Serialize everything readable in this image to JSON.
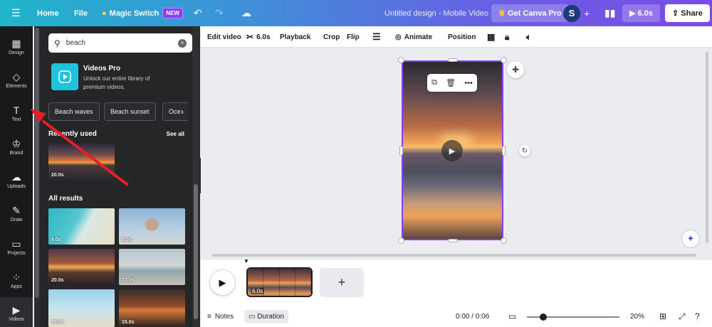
{
  "topbar": {
    "home": "Home",
    "file": "File",
    "magic_switch": "Magic Switch",
    "new_badge": "NEW",
    "design_title": "Untitled design - Mobile Video",
    "get_pro": "Get Canva Pro",
    "avatar_letter": "S",
    "play_duration": "6.0s",
    "share": "Share"
  },
  "rail": {
    "items": [
      {
        "label": "Design",
        "icon": "layout-icon"
      },
      {
        "label": "Elements",
        "icon": "shapes-icon"
      },
      {
        "label": "Text",
        "icon": "text-icon"
      },
      {
        "label": "Brand",
        "icon": "brand-icon"
      },
      {
        "label": "Uploads",
        "icon": "upload-icon"
      },
      {
        "label": "Draw",
        "icon": "draw-icon"
      },
      {
        "label": "Projects",
        "icon": "folder-icon"
      },
      {
        "label": "Apps",
        "icon": "apps-icon"
      },
      {
        "label": "Videos",
        "icon": "video-icon"
      }
    ]
  },
  "panel": {
    "search_value": "beach",
    "videos_pro_title": "Videos Pro",
    "videos_pro_desc": "Unlock our entire library of premium videos.",
    "chips": [
      "Beach waves",
      "Beach sunset",
      "Oce"
    ],
    "recently_used": "Recently used",
    "see_all": "See all",
    "recent_duration": "20.0s",
    "all_results": "All results",
    "results": [
      "9.0s",
      "8.0s",
      "20.0s",
      "17.0s",
      "36.0s",
      "15.0s"
    ]
  },
  "toolbar": {
    "edit_video": "Edit video",
    "trim_duration": "6.0s",
    "playback": "Playback",
    "crop": "Crop",
    "flip": "Flip",
    "animate": "Animate",
    "position": "Position"
  },
  "timeline": {
    "clip_duration": "6.0s"
  },
  "bottombar": {
    "notes": "Notes",
    "duration": "Duration",
    "time": "0:00 / 0:06",
    "zoom": "20%"
  },
  "colors": {
    "accent_purple": "#8b3dff",
    "arrow_red": "#e41f26"
  }
}
